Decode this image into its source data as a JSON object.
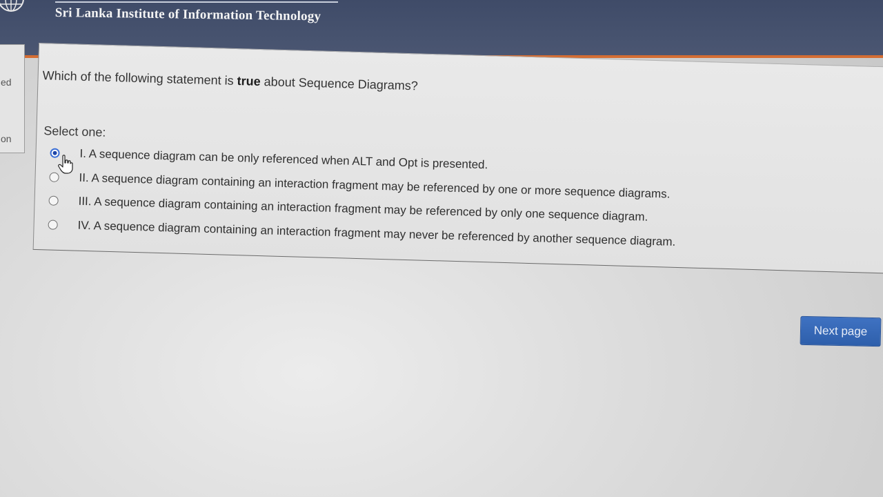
{
  "header": {
    "institution_name": "Sri Lanka Institute of Information Technology",
    "logo_icon": "globe-icon"
  },
  "left_nav": {
    "fragment_1": "ed",
    "fragment_2": "on"
  },
  "question": {
    "text_before": "Which of the following statement is ",
    "text_bold": "true",
    "text_after": " about Sequence Diagrams?",
    "select_label": "Select one:",
    "selected_index": 0,
    "options": [
      {
        "label": "I. A sequence diagram can be only referenced when ALT and Opt is presented."
      },
      {
        "label": "II. A sequence diagram containing an interaction fragment may be referenced by one or more sequence diagrams."
      },
      {
        "label": "III. A sequence diagram containing an interaction fragment may be referenced by only one sequence diagram."
      },
      {
        "label": "IV. A sequence diagram containing an interaction fragment may never be referenced by another sequence diagram."
      }
    ]
  },
  "navigation": {
    "next_label": "Next page"
  },
  "colors": {
    "header_bg": "#44506d",
    "header_accent": "#d46d33",
    "radio_selected": "#1e46a8",
    "button_bg": "#3566b6"
  }
}
